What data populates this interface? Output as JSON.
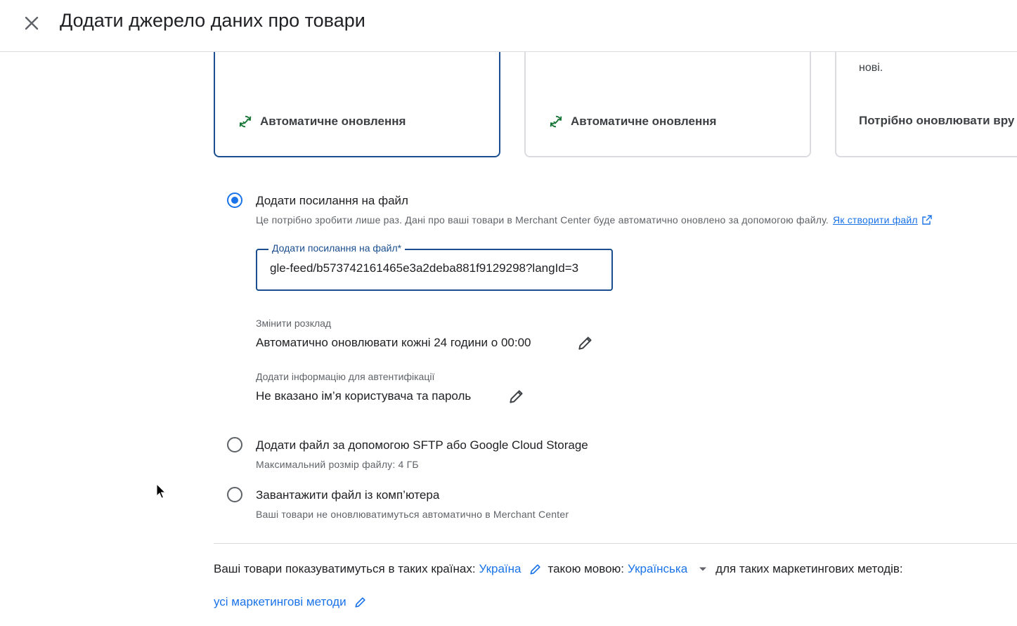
{
  "header": {
    "title": "Додати джерело даних про товари",
    "close_icon": "close-icon"
  },
  "cards": [
    {
      "description": "",
      "update_label": "Автоматичне оновлення",
      "selected": true
    },
    {
      "description": "",
      "update_label": "Автоматичне оновлення",
      "selected": false
    },
    {
      "description": "нові.",
      "update_label": "Потрібно оновлювати вру",
      "selected": false
    }
  ],
  "options": {
    "link": {
      "label": "Додати посилання на файл",
      "description": "Це потрібно зробити лише раз. Дані про ваші товари в Merchant Center буде автоматично оновлено за допомогою файлу.",
      "help_link": "Як створити файл",
      "field_label": "Додати посилання на файл*",
      "field_value": "gle-feed/b573742161465e3a2deba881f9129298?langId=3",
      "schedule_caption": "Змінити розклад",
      "schedule_value": "Автоматично оновлювати кожні 24 години о 00:00",
      "auth_caption": "Додати інформацію для автентифікації",
      "auth_value": "Не вказано ім’я користувача та пароль"
    },
    "sftp": {
      "label": "Додати файл за допомогою SFTP або Google Cloud Storage",
      "description": "Максимальний розмір файлу: 4 ГБ"
    },
    "upload": {
      "label": "Завантажити файл із комп’ютера",
      "description": "Ваші товари не оновлюватимуться автоматично в Merchant Center"
    }
  },
  "footer": {
    "countries_prefix": "Ваші товари показуватимуться в таких країнах:",
    "country": "Україна",
    "language_prefix": "такою мовою:",
    "language": "Українська",
    "methods_prefix": "для таких маркетингових методів:",
    "methods": "усі маркетингові методи"
  },
  "colors": {
    "accent": "#1a73e8",
    "selected_border": "#1a4e8f",
    "update_icon": "#137333"
  }
}
